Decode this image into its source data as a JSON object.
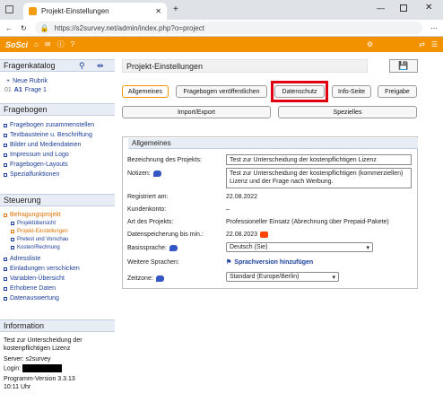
{
  "browser": {
    "tab_title": "Projekt-Einstellungen",
    "url": "https://s2survey.net/admin/index.php?o=project"
  },
  "appbar": {
    "logo": "SoSci"
  },
  "sidebar": {
    "fragenkatalog": {
      "title": "Fragenkatalog",
      "new_rubric": "Neue Rubrik",
      "rubric": {
        "num": "01",
        "code": "A1",
        "label": "Frage 1"
      }
    },
    "fragebogen": {
      "title": "Fragebogen",
      "items": [
        "Fragebogen zusammenstellen",
        "Textbausteine u. Beschriftung",
        "Bilder und Mediendateien",
        "Impressum und Logo",
        "Fragebogen-Layouts",
        "Spezialfunktionen"
      ]
    },
    "steuerung": {
      "title": "Steuerung",
      "befragungsprojekt": "Befragungsprojekt",
      "subitems": [
        "Projektübersicht",
        "Projekt-Einstellungen",
        "Pretest und Vorschau",
        "Kosten/Rechnung"
      ],
      "items": [
        "Adressliste",
        "Einladungen verschicken",
        "Variablen-Übersicht",
        "Erhobene Daten",
        "Datenauswertung"
      ]
    },
    "information": {
      "title": "Information",
      "project_line1": "Test zur Unterscheidung der",
      "project_line2": "kostenpflichtigen Lizenz",
      "server": "Server: s2survey",
      "login": "Login:",
      "version": "Programm-Version 3.3.13",
      "time": "10:11 Uhr"
    }
  },
  "main": {
    "title": "Projekt-Einstellungen",
    "tabs_row1": [
      "Allgemeines",
      "Fragebogen veröffentlichen",
      "Datenschutz",
      "Info-Seite",
      "Freigabe"
    ],
    "tabs_row2": [
      "Import/Export",
      "Spezielles"
    ],
    "section_title": "Allgemeines",
    "fields": {
      "name_label": "Bezeichnung des Projekts:",
      "name_value": "Test zur Unterscheidung der kostenpflichtigen Lizenz",
      "notes_label": "Notizen:",
      "notes_value": "Test zur Unterscheidung der kostenpflichtigen (kommerziellen) Lizenz und der Frage nach Werbung.",
      "registered_label": "Registriert am:",
      "registered_value": "22.08.2022",
      "account_label": "Kundenkonto:",
      "account_value": "–",
      "type_label": "Art des Projekts:",
      "type_value": "Professioneller Einsatz (Abrechnung über Prepaid-Pakete)",
      "storage_label": "Datenspeicherung bis min.:",
      "storage_value": "22.08.2023",
      "lang_label": "Basissprache:",
      "lang_value": "Deutsch (Sie)",
      "more_lang_label": "Weitere Sprachen:",
      "more_lang_link": "Sprachversion hinzufügen",
      "tz_label": "Zeitzone:",
      "tz_value": "Standard (Europe/Berlin)"
    }
  },
  "colors": {
    "accent": "#f39200",
    "link": "#1a3d99",
    "highlight": "#e00010"
  }
}
